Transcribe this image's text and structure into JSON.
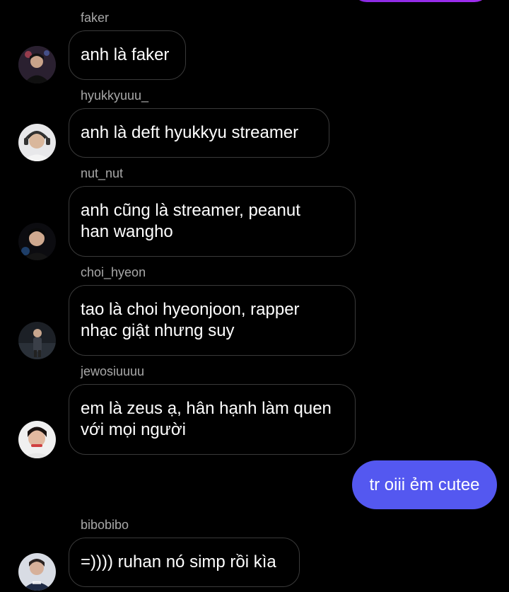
{
  "messages": [
    {
      "username": "faker",
      "text": "anh là faker",
      "avatar": "avatar-faker"
    },
    {
      "username": "hyukkyuuu_",
      "text": "anh là deft hyukkyu streamer",
      "avatar": "avatar-hyukkyuuu"
    },
    {
      "username": "nut_nut",
      "text": "anh cũng là streamer, peanut\nhan wangho",
      "avatar": "avatar-nut-nut"
    },
    {
      "username": "choi_hyeon",
      "text": "tao là choi hyeonjoon, rapper\nnhạc giật nhưng suy",
      "avatar": "avatar-choi-hyeon"
    },
    {
      "username": "jewosiuuuu",
      "text": "em là zeus ạ, hân hạnh làm quen\nvới mọi người",
      "avatar": "avatar-jewosiuuuu"
    },
    {
      "username": "bibobibo",
      "text": "=)))) ruhan nó simp rồi kìa",
      "avatar": "avatar-bibobibo"
    }
  ],
  "sent_message": {
    "text": "tr oiii ẻm cutee"
  },
  "colors": {
    "background": "#000000",
    "sent_bubble": "#5458f0",
    "top_bubble": "#9a2cf0",
    "received_border": "#3a3a3a",
    "username": "#a8a8a8"
  }
}
